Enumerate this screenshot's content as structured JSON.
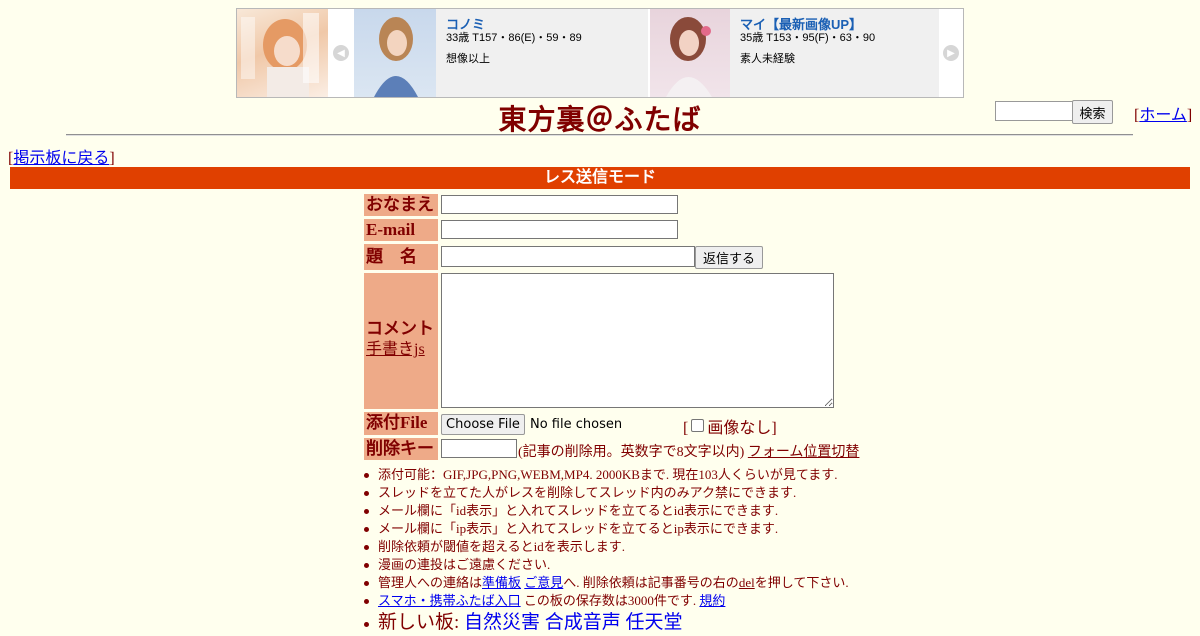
{
  "banner": {
    "prev_icon": "chevron-left-icon",
    "next_icon": "chevron-right-icon",
    "cards": [
      {
        "name": "コノミ",
        "stats": "33歳 T157・86(E)・59・89",
        "desc": "想像以上"
      },
      {
        "name": "マイ【最新画像UP】",
        "stats": "35歳 T153・95(F)・63・90",
        "desc": "素人未経験"
      }
    ]
  },
  "header": {
    "title": "東方裏＠ふたば",
    "search_button": "検索",
    "home_open": "[",
    "home_link": "ホーム",
    "home_close": "]",
    "back_open": "[",
    "back_link": "掲示板に戻る",
    "back_close": "]"
  },
  "mode_bar": "レス送信モード",
  "form": {
    "name_label": "おなまえ",
    "email_label": "E-mail",
    "subject_label": "題　名",
    "reply_button": "返信する",
    "comment_label": "コメント",
    "handwrite_link": "手書きjs",
    "file_label": "添付File",
    "file_button": "Choose File",
    "file_status": "No file chosen",
    "noimage_open": "[",
    "noimage_label": "画像なし",
    "noimage_close": "]",
    "delkey_label": "削除キー",
    "delkey_note": "(記事の削除用。英数字で8文字以内)",
    "form_position_link": "フォーム位置切替"
  },
  "notes": {
    "n1": "添付可能：GIF,JPG,PNG,WEBM,MP4. 2000KBまで. 現在103人くらいが見てます.",
    "n2": "スレッドを立てた人がレスを削除してスレッド内のみアク禁にできます.",
    "n3": "メール欄に「id表示」と入れてスレッドを立てるとid表示にできます.",
    "n4": "メール欄に「ip表示」と入れてスレッドを立てるとip表示にできます.",
    "n5": "削除依頼が閾値を超えるとidを表示します.",
    "n6": "漫画の連投はご遠慮ください.",
    "n7_a": "管理人への連絡は",
    "n7_link1": "準備板",
    "n7_link2": "ご意見",
    "n7_b": "へ. 削除依頼は記事番号の右の",
    "n7_del": "del",
    "n7_c": "を押して下さい.",
    "n8_link": "スマホ・携帯ふたば入口",
    "n8_text": " この板の保存数は3000件です.",
    "n8_rules": "規約",
    "n9_text": "新しい板: ",
    "n9_link": "自然災害 合成音声 任天堂"
  },
  "colors": {
    "page_bg": "#ffffee",
    "text": "#800000",
    "mode_bar": "#e04000",
    "label_bg": "#eeaa88",
    "link": "#0000ee"
  }
}
